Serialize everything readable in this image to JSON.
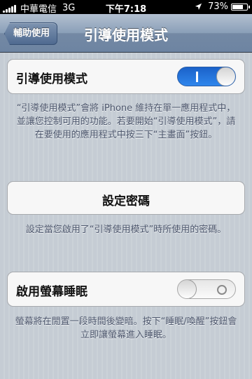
{
  "status_bar": {
    "carrier": "中華電信",
    "network": "3G",
    "time": "下午7:18",
    "battery": "73%",
    "battery_level": 0.73
  },
  "nav": {
    "back_label": "輔助使用",
    "title": "引導使用模式"
  },
  "guided_access": {
    "label": "引導使用模式",
    "enabled": true,
    "on_indicator": "I",
    "description": "“引導使用模式”會將 iPhone 維持在單一應用程式中，並讓您控制可用的功能。若要開始“引導使用模式”，請在要使用的應用程式中按三下“主畫面”按鈕。"
  },
  "passcode": {
    "button_label": "設定密碼",
    "description": "設定當您啟用了“引導使用模式”時所使用的密碼。"
  },
  "screen_sleep": {
    "label": "啟用螢幕睡眠",
    "enabled": false,
    "off_indicator": "O",
    "description": "螢幕將在閒置一段時間後變暗。按下“睡眠/喚醒”按鈕會立即讓螢幕進入睡眠。"
  }
}
